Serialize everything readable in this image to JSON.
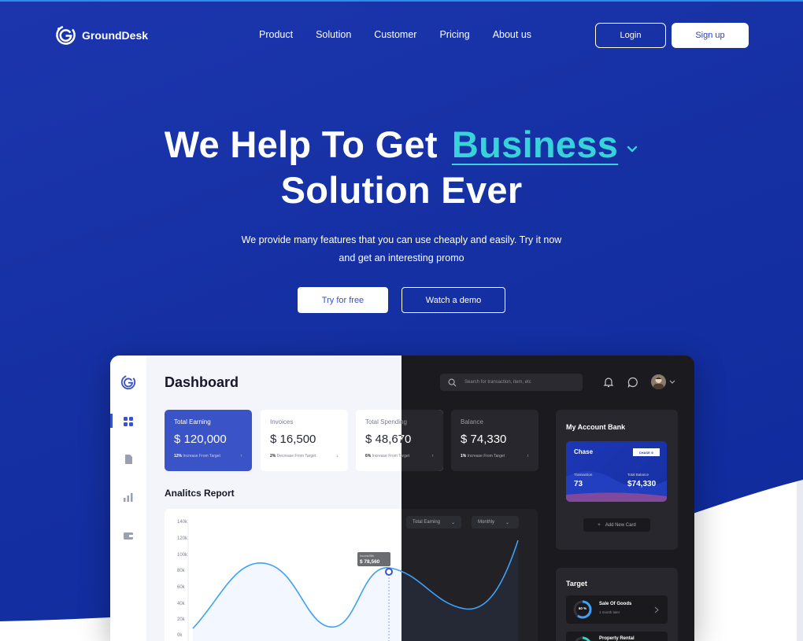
{
  "colors": {
    "hero_blue": "#1a34aa",
    "accent_teal": "#37d3d8",
    "card_blue": "#3a53c7",
    "dark_panel": "#27272d"
  },
  "nav": {
    "brand": "GroundDesk",
    "menu": [
      "Product",
      "Solution",
      "Customer",
      "Pricing",
      "About us"
    ],
    "login": "Login",
    "signup": "Sign up"
  },
  "hero": {
    "title_part1": "We Help To Get",
    "title_accent": "Business",
    "title_line2": "Solution Ever",
    "subtitle_line1": "We provide many features that you can use cheaply and easily. Try it now",
    "subtitle_line2": "and get an interesting promo",
    "cta_primary": "Try for free",
    "cta_secondary": "Watch a demo"
  },
  "dashboard": {
    "title": "Dashboard",
    "search_placeholder": "Search for transaction, item, etc",
    "cards": [
      {
        "label": "Total Earning",
        "value": "$ 120,000",
        "pct": "12%",
        "note": "Increase From Target",
        "trend": "↑"
      },
      {
        "label": "Invoices",
        "value": "$ 16,500",
        "pct": "2%",
        "note": "Decrease From Target",
        "trend": "↓"
      },
      {
        "label": "Total Spending",
        "value": "$ 48,670",
        "pct": "6%",
        "note": "Increase From Target",
        "trend": "↑"
      },
      {
        "label": "Balance",
        "value": "$ 74,330",
        "pct": "1%",
        "note": "Increase From Target",
        "trend": "↑"
      }
    ],
    "analytics_title": "Analitcs Report",
    "chart_filter_1": "Total Earning",
    "chart_filter_2": "Monthly",
    "chart_tooltip_label": "Income/Mth",
    "chart_tooltip_value": "$ 78,560",
    "y_ticks": [
      "140k",
      "120k",
      "100k",
      "80k",
      "60k",
      "40k",
      "20k",
      "0k"
    ],
    "bank": {
      "title": "My Account Bank",
      "card_name": "Chase",
      "card_badge": "CHASE ⊙",
      "transaction_label": "Transaction",
      "transaction_value": "73",
      "balance_label": "Total Balance",
      "balance_value": "$74,330",
      "add_card": "Add New Card"
    },
    "target": {
      "title": "Target",
      "goals": [
        {
          "name": "Sale Of Goods",
          "sub": "1 month later",
          "pct": "60 %"
        },
        {
          "name": "Property Rental",
          "sub": "",
          "pct": ""
        }
      ]
    }
  }
}
